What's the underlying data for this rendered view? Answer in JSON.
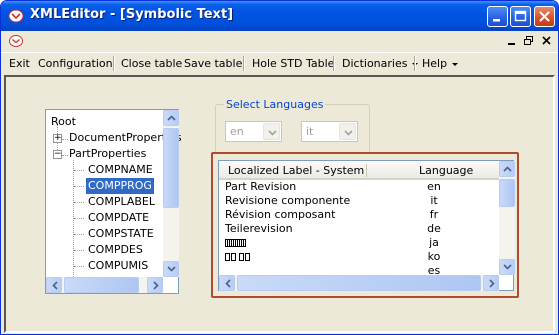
{
  "window": {
    "title": "XMLEditor - [Symbolic Text]",
    "controls": {
      "minimize": "minimize-icon",
      "maximize": "maximize-icon",
      "close": "close-icon"
    }
  },
  "menu": {
    "exit": "Exit",
    "configuration": "Configuration",
    "close_table": "Close table",
    "save_table": "Save table",
    "hole_std_table": "Hole STD Table",
    "dictionaries": "Dictionaries",
    "help": "Help"
  },
  "tree": {
    "root": "Root",
    "document_properties": "DocumentProperties",
    "part_properties": "PartProperties",
    "children": [
      "COMPNAME",
      "COMPPROG",
      "COMPLABEL",
      "COMPDATE",
      "COMPSTATE",
      "COMPDES",
      "COMPUMIS"
    ],
    "selected": "COMPPROG"
  },
  "languages": {
    "group_title": "Select Languages",
    "from_value": "en",
    "to_value": "it"
  },
  "table": {
    "columns": [
      "Localized Label - System",
      "Language"
    ],
    "rows": [
      {
        "label": "Part Revision",
        "language": "en"
      },
      {
        "label": "Revisione componente",
        "language": "it"
      },
      {
        "label": "Révision composant",
        "language": "fr"
      },
      {
        "label": "Teilerevision",
        "language": "de"
      },
      {
        "label": "",
        "language": "ja"
      },
      {
        "label": "",
        "language": "ko"
      },
      {
        "label": "",
        "language": "es"
      }
    ]
  },
  "colors": {
    "title_bar": "#0054e3",
    "selection": "#316ac5",
    "highlight_frame": "#b14b2f",
    "group_title": "#0046d5"
  }
}
